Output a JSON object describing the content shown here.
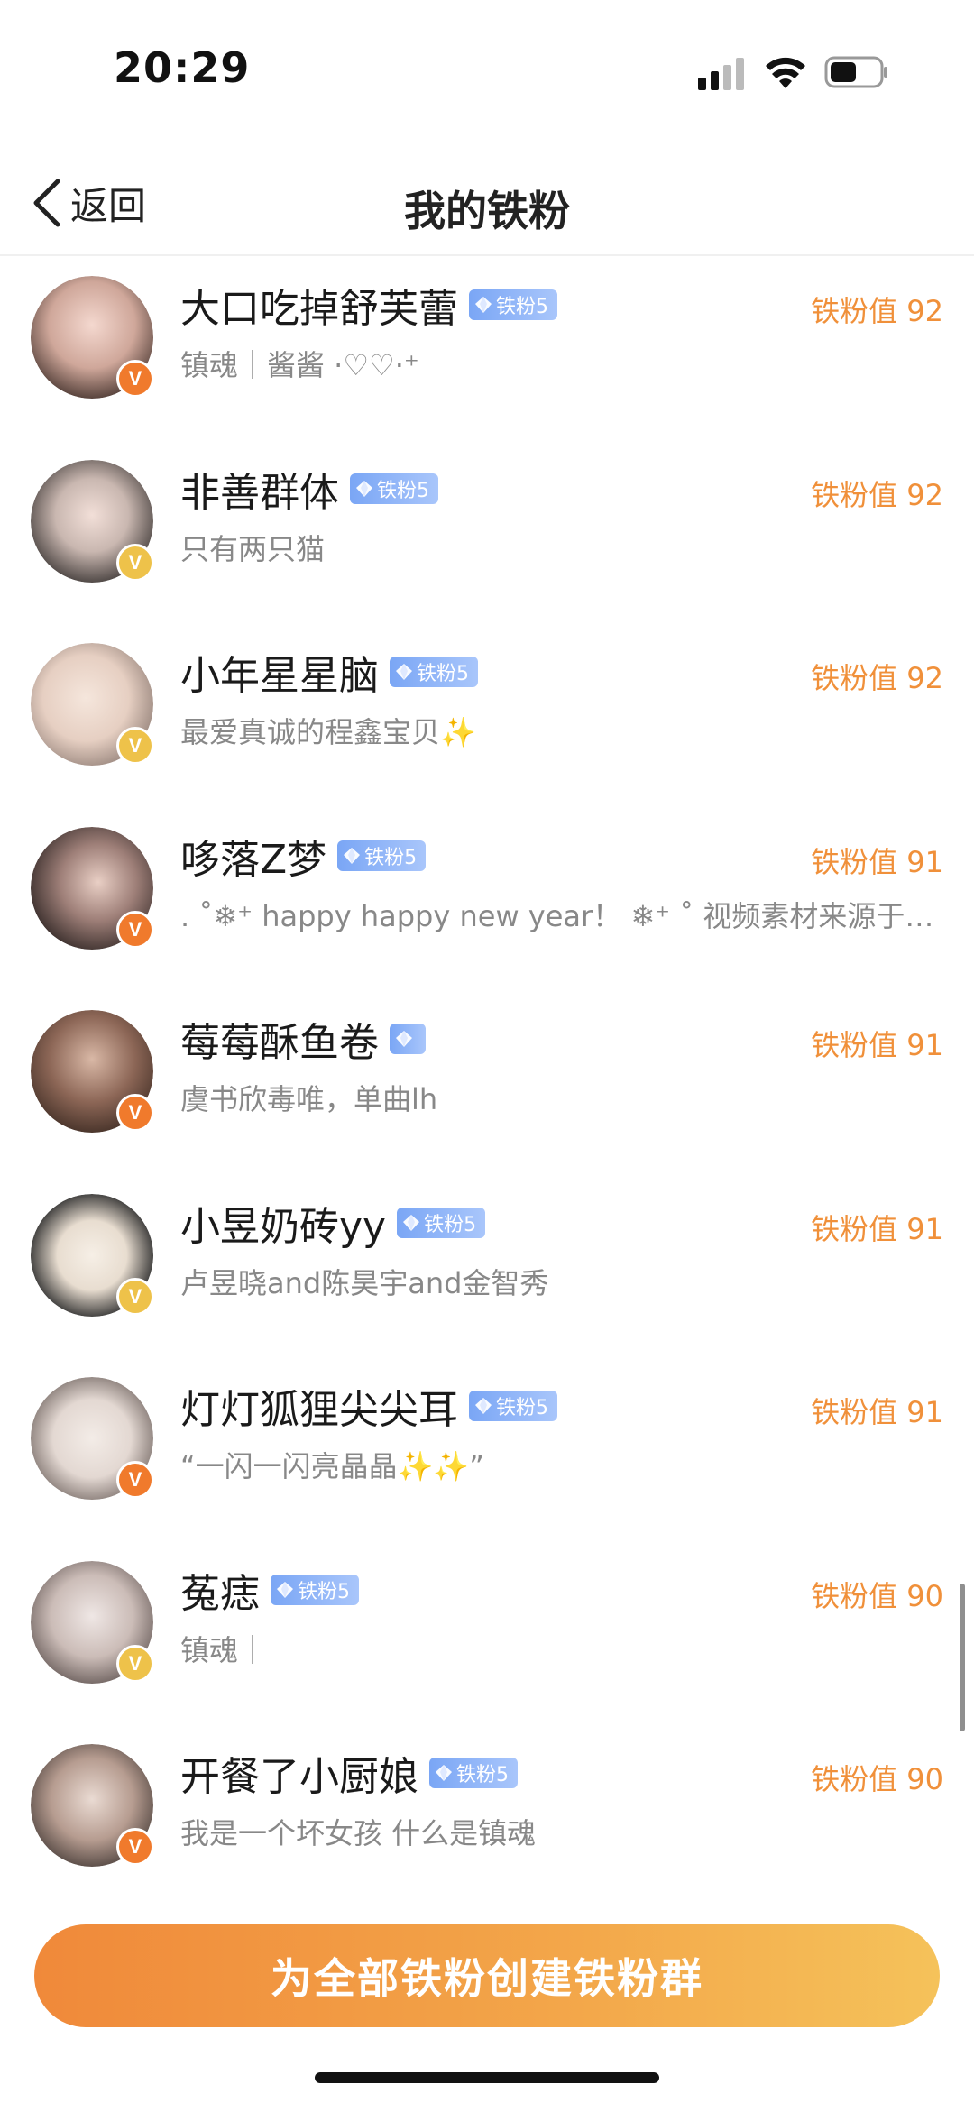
{
  "status_bar": {
    "time": "20:29"
  },
  "nav": {
    "back_label": "返回",
    "title": "我的铁粉"
  },
  "colors": {
    "accent": "#f0903a",
    "badge_orange": "#f07a2c",
    "badge_yellow": "#eec24a",
    "fan_badge": "#7aa6f5"
  },
  "fans": [
    {
      "name": "大口吃掉舒芙蕾",
      "badge": "铁粉5",
      "value": "铁粉值 92",
      "signature": "镇魂｜酱酱 ·♡♡·⁺",
      "v_color": "orange"
    },
    {
      "name": "非善群体",
      "badge": "铁粉5",
      "value": "铁粉值 92",
      "signature": "只有两只猫",
      "v_color": "yellow"
    },
    {
      "name": "小年星星脑",
      "badge": "铁粉5",
      "value": "铁粉值 92",
      "signature": "最爱真诚的程鑫宝贝✨",
      "v_color": "yellow"
    },
    {
      "name": "哆落Z梦",
      "badge": "铁粉5",
      "value": "铁粉值 91",
      "signature": ". ˚❄⁺ happy happy new year！ ❄⁺ ˚ 视频素材来源于网络…",
      "v_color": "orange"
    },
    {
      "name": "莓莓酥鱼卷",
      "badge": "",
      "value": "铁粉值 91",
      "signature": "虞书欣毒唯，单曲lh",
      "v_color": "orange"
    },
    {
      "name": "小昱奶砖yy",
      "badge": "铁粉5",
      "value": "铁粉值 91",
      "signature": "卢昱晓and陈昊宇and金智秀",
      "v_color": "yellow"
    },
    {
      "name": "灯灯狐狸尖尖耳",
      "badge": "铁粉5",
      "value": "铁粉值 91",
      "signature": "“一闪一闪亮晶晶✨✨”",
      "v_color": "orange"
    },
    {
      "name": "菟痣",
      "badge": "铁粉5",
      "value": "铁粉值 90",
      "signature": "镇魂｜",
      "v_color": "yellow"
    },
    {
      "name": "开餐了小厨娘",
      "badge": "铁粉5",
      "value": "铁粉值 90",
      "signature": "我是一个坏女孩 什么是镇魂",
      "v_color": "orange"
    }
  ],
  "bottom": {
    "create_label": "为全部铁粉创建铁粉群"
  }
}
